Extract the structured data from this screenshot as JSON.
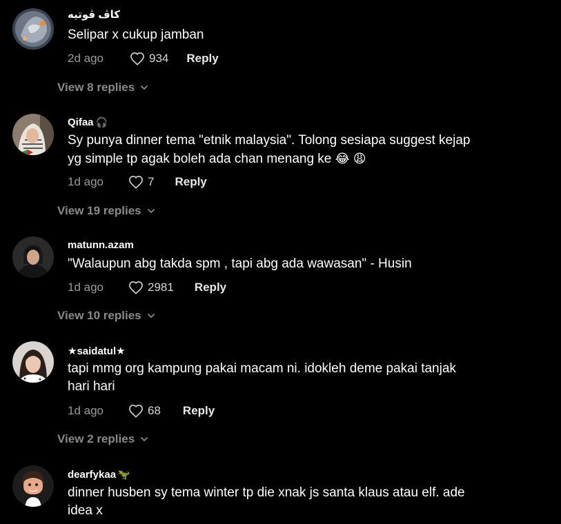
{
  "comments": [
    {
      "username": "کاڤ ڤوتيه",
      "deco": "",
      "text": "Selipar x cukup jamban",
      "time": "2d ago",
      "likes": "934",
      "reply_label": "Reply",
      "view_replies": "View 8 replies",
      "avatar_icon": "dragon-avatar-icon"
    },
    {
      "username": "Qifaa",
      "deco": "🎧",
      "text_line1": "Sy punya dinner tema \"etnik malaysia\". Tolong sesiapa suggest kejap",
      "text_line2": "yg simple tp agak boleh ada chan menang ke",
      "emojis": "😂 😩",
      "time": "1d ago",
      "likes": "7",
      "reply_label": "Reply",
      "view_replies": "View 19 replies",
      "avatar_icon": "woman-keffiyeh-avatar-icon"
    },
    {
      "username": "matunn.azam",
      "deco": "",
      "text": "\"Walaupun abg takda spm , tapi abg ada wawasan\" - Husin",
      "time": "1d ago",
      "likes": "2981",
      "reply_label": "Reply",
      "view_replies": "View 10 replies",
      "avatar_icon": "person-avatar-icon"
    },
    {
      "username": "★saidatul★",
      "deco": "",
      "text_line1": "tapi mmg org kampung pakai macam ni. idokleh deme pakai tanjak",
      "text_line2": "hari hari",
      "time": "1d ago",
      "likes": "68",
      "reply_label": "Reply",
      "view_replies": "View 2 replies",
      "avatar_icon": "girl-avatar-icon"
    },
    {
      "username": "dearfykaa",
      "deco": "🦖",
      "text_line1": "dinner husben sy tema winter tp die xnak js santa klaus atau elf. ade",
      "text_line2": "idea x",
      "avatar_icon": "memoji-avatar-icon"
    }
  ],
  "colors": {
    "background": "#000000",
    "text": "#ffffff",
    "muted": "#9a9a9a",
    "view_replies": "#8a8a8a"
  }
}
